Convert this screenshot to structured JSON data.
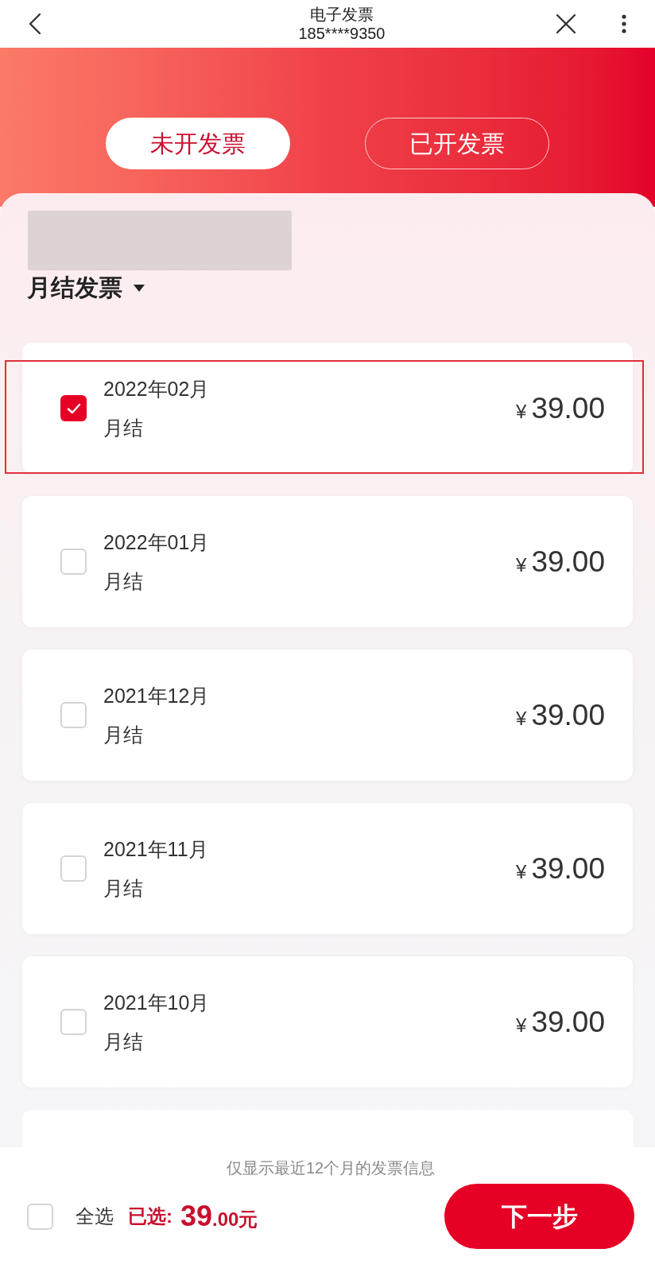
{
  "header": {
    "title": "电子发票",
    "subtitle": "185****9350"
  },
  "tabs": [
    {
      "label": "未开发票",
      "selected": true
    },
    {
      "label": "已开发票",
      "selected": false
    }
  ],
  "section": {
    "title": "月结发票"
  },
  "invoices": [
    {
      "period": "2022年02月",
      "type": "月结",
      "currency": "¥",
      "amount": "39.00",
      "checked": true,
      "highlighted": true
    },
    {
      "period": "2022年01月",
      "type": "月结",
      "currency": "¥",
      "amount": "39.00",
      "checked": false,
      "highlighted": false
    },
    {
      "period": "2021年12月",
      "type": "月结",
      "currency": "¥",
      "amount": "39.00",
      "checked": false,
      "highlighted": false
    },
    {
      "period": "2021年11月",
      "type": "月结",
      "currency": "¥",
      "amount": "39.00",
      "checked": false,
      "highlighted": false
    },
    {
      "period": "2021年10月",
      "type": "月结",
      "currency": "¥",
      "amount": "39.00",
      "checked": false,
      "highlighted": false
    }
  ],
  "footer": {
    "note": "仅显示最近12个月的发票信息",
    "select_all": {
      "label": "全选",
      "checked": false
    },
    "selected_label": "已选:",
    "total_integer": "39",
    "total_decimal": ".00元",
    "next_button": "下一步"
  }
}
